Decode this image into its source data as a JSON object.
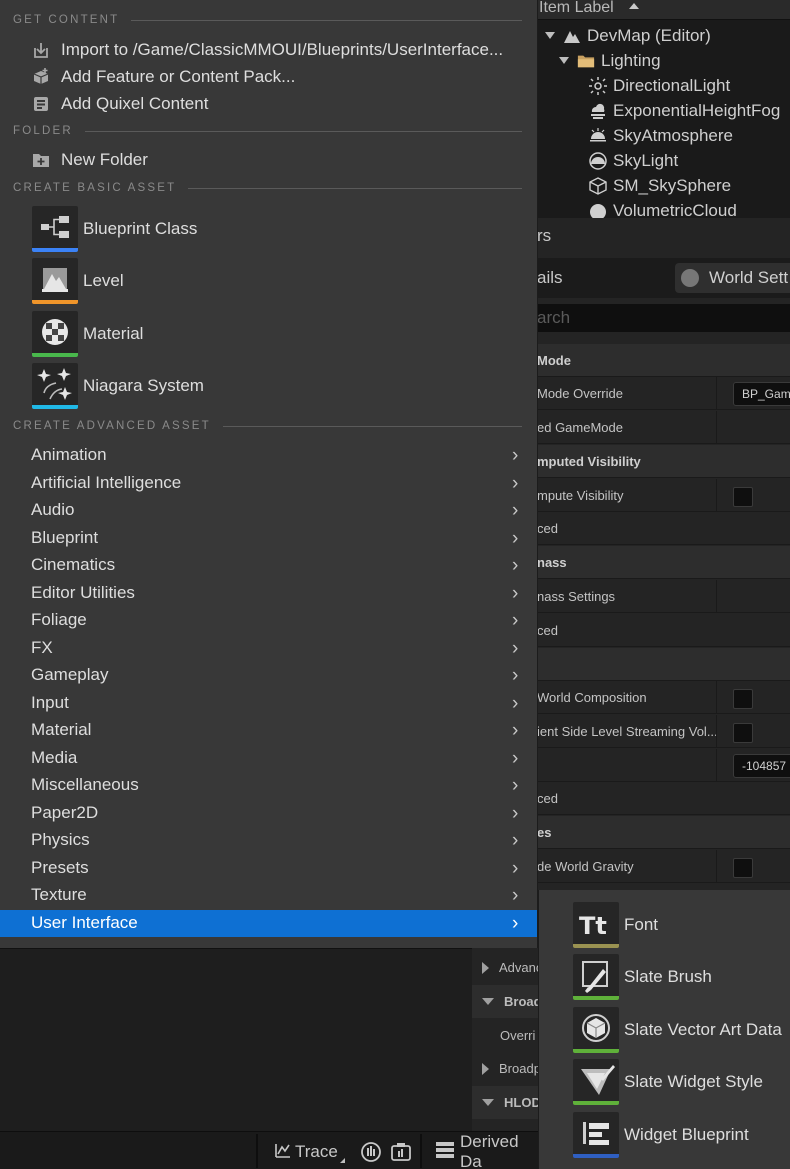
{
  "outliner": {
    "header": "Item Label",
    "items": [
      {
        "label": "DevMap (Editor)",
        "icon": "map-icon"
      },
      {
        "label": "Lighting",
        "icon": "folder-icon"
      },
      {
        "label": "DirectionalLight",
        "icon": "sun-icon"
      },
      {
        "label": "ExponentialHeightFog",
        "icon": "fog-icon"
      },
      {
        "label": "SkyAtmosphere",
        "icon": "atmosphere-icon"
      },
      {
        "label": "SkyLight",
        "icon": "skylight-icon"
      },
      {
        "label": "SM_SkySphere",
        "icon": "cube-icon"
      },
      {
        "label": "VolumetricCloud",
        "icon": "cloud-icon"
      }
    ]
  },
  "details": {
    "panel_title": "rs",
    "tab_details": "ails",
    "tab_world": "World Sett",
    "search_placeholder": "arch",
    "rows": [
      {
        "label": "Mode",
        "type": "cat"
      },
      {
        "label": "Mode Override",
        "type": "prop",
        "value": "BP_Gam"
      },
      {
        "label": "ed GameMode",
        "type": "prop"
      },
      {
        "label": "mputed Visibility",
        "type": "cat"
      },
      {
        "label": "mpute Visibility",
        "type": "prop",
        "checkbox": true
      },
      {
        "label": "ced",
        "type": "prop"
      },
      {
        "label": "nass",
        "type": "cat"
      },
      {
        "label": "nass Settings",
        "type": "prop"
      },
      {
        "label": "ced",
        "type": "prop"
      },
      {
        "label": "",
        "type": "cat"
      },
      {
        "label": " World Composition",
        "type": "prop",
        "checkbox": true
      },
      {
        "label": "ient Side Level Streaming Vol...",
        "type": "prop",
        "checkbox": true
      },
      {
        "label": "",
        "type": "prop",
        "value": "-104857"
      },
      {
        "label": "ced",
        "type": "prop"
      },
      {
        "label": "es",
        "type": "cat"
      },
      {
        "label": "de World Gravity",
        "type": "prop",
        "checkbox": true
      }
    ]
  },
  "bottom_panel": {
    "rows": [
      {
        "label": "Advanc",
        "type": "prop",
        "arrow": "right"
      },
      {
        "label": "Broadp",
        "type": "cat",
        "arrow": "down"
      },
      {
        "label": "Overri",
        "type": "prop",
        "arrow": "none"
      },
      {
        "label": "Broadp",
        "type": "prop",
        "arrow": "right"
      },
      {
        "label": "HLODS",
        "type": "cat",
        "arrow": "down"
      }
    ]
  },
  "statusbar": {
    "trace_label": "Trace",
    "derived_label": "Derived Da"
  },
  "menu": {
    "sections": {
      "get_content": "GET CONTENT",
      "folder": "FOLDER",
      "basic": "CREATE BASIC ASSET",
      "advanced": "CREATE ADVANCED ASSET"
    },
    "get_content_items": [
      {
        "label": "Import to /Game/ClassicMMOUI/Blueprints/UserInterface...",
        "icon": "import-icon"
      },
      {
        "label": "Add Feature or Content Pack...",
        "icon": "content-pack-icon"
      },
      {
        "label": "Add Quixel Content",
        "icon": "quixel-icon"
      }
    ],
    "folder_items": [
      {
        "label": "New Folder",
        "icon": "new-folder-icon"
      }
    ],
    "basic_assets": [
      {
        "label": "Blueprint Class",
        "icon": "blueprint-class-icon",
        "color": "#3b82f6"
      },
      {
        "label": "Level",
        "icon": "level-icon",
        "color": "#f0952a"
      },
      {
        "label": "Material",
        "icon": "material-icon",
        "color": "#49b84c"
      },
      {
        "label": "Niagara System",
        "icon": "niagara-icon",
        "color": "#20b8e6"
      }
    ],
    "advanced_categories": [
      "Animation",
      "Artificial Intelligence",
      "Audio",
      "Blueprint",
      "Cinematics",
      "Editor Utilities",
      "Foliage",
      "FX",
      "Gameplay",
      "Input",
      "Material",
      "Media",
      "Miscellaneous",
      "Paper2D",
      "Physics",
      "Presets",
      "Texture",
      "User Interface"
    ],
    "highlighted": "User Interface",
    "highlight_color": "#0e70d3"
  },
  "submenu": {
    "items": [
      {
        "label": "Font",
        "icon": "font-icon",
        "color": "#9a9251"
      },
      {
        "label": "Slate Brush",
        "icon": "slate-brush-icon",
        "color": "#5fb13a"
      },
      {
        "label": "Slate Vector Art Data",
        "icon": "vector-art-icon",
        "color": "#5fb13a"
      },
      {
        "label": "Slate Widget Style",
        "icon": "widget-style-icon",
        "color": "#5fb13a"
      },
      {
        "label": "Widget Blueprint",
        "icon": "widget-blueprint-icon",
        "color": "#2f5fc2"
      }
    ]
  }
}
